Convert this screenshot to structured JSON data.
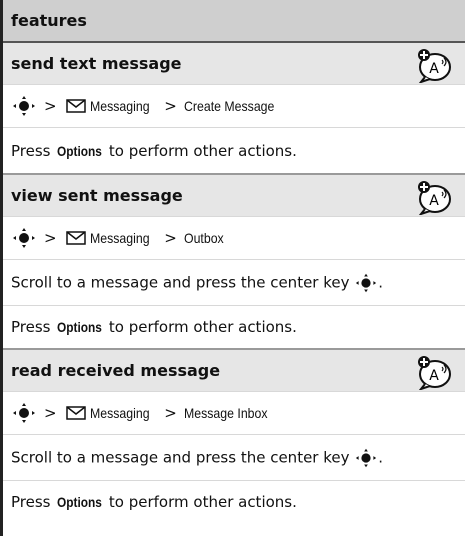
{
  "header": {
    "title": "features"
  },
  "sections": [
    {
      "title": "send text message",
      "path": [
        "Messaging",
        "Create Message"
      ],
      "lines": [
        {
          "pre": "Press ",
          "key": "Options",
          "post": " to perform other actions."
        }
      ]
    },
    {
      "title": "view sent message",
      "path": [
        "Messaging",
        "Outbox"
      ],
      "lines": [
        {
          "pre": "Scroll to a message and press the center key",
          "nav": true
        },
        {
          "pre": "Press ",
          "key": "Options",
          "post": " to perform other actions."
        }
      ]
    },
    {
      "title": "read received message",
      "path": [
        "Messaging",
        "Message Inbox"
      ],
      "lines": [
        {
          "pre": "Scroll to a message and press the center key",
          "nav": true
        },
        {
          "pre": "Press ",
          "key": "Options",
          "post": " to perform other actions."
        }
      ]
    }
  ],
  "symbols": {
    "gt": ">",
    "period": "."
  },
  "icons": {
    "nav": "nav-key-icon",
    "message": "envelope-icon",
    "feature": "ptt-bubble-icon"
  },
  "colors": {
    "header_bg": "#cfcfcf",
    "title_bg": "#e6e6e6",
    "separator": "#9a9a9a"
  }
}
